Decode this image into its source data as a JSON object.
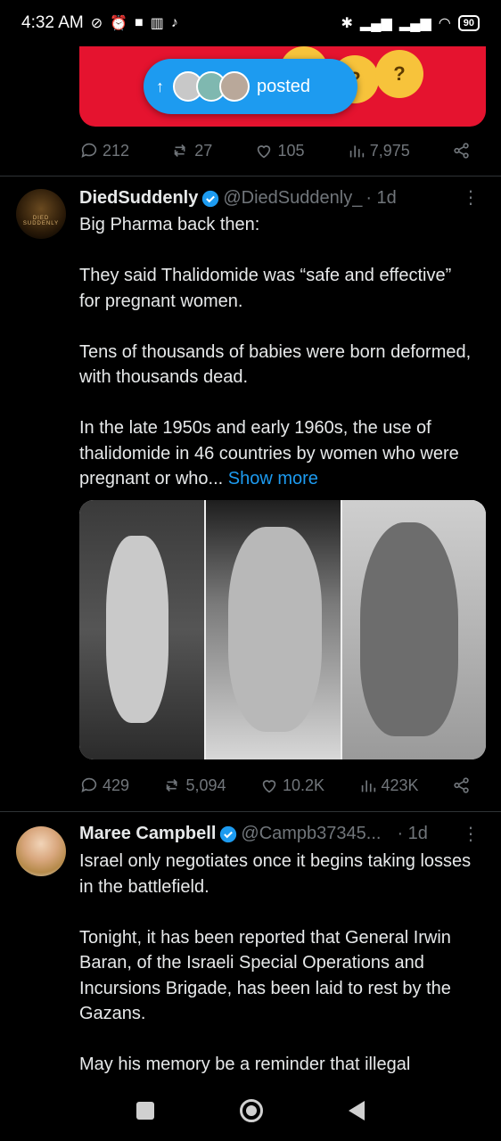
{
  "status_bar": {
    "time": "4:32 AM",
    "battery": "90"
  },
  "posted_pill": {
    "label": "posted"
  },
  "prev_tweet_actions": {
    "replies": "212",
    "reposts": "27",
    "likes": "105",
    "views": "7,975"
  },
  "tweet1": {
    "name": "DiedSuddenly",
    "handle": "@DiedSuddenly_",
    "time": "· 1d",
    "avatar_text": "DIED SUDDENLY",
    "paragraphs": [
      "Big Pharma back then:",
      "They said Thalidomide was “safe and effective” for pregnant women.",
      "Tens of thousands of babies were born deformed, with thousands dead.",
      "In the late 1950s and early 1960s, the use of thalidomide in 46 countries by women who were pregnant or who..."
    ],
    "show_more": "Show more",
    "actions": {
      "replies": "429",
      "reposts": "5,094",
      "likes": "10.2K",
      "views": "423K"
    }
  },
  "tweet2": {
    "name": "Maree Campbell",
    "handle": "@Campb37345...",
    "time": "· 1d",
    "paragraphs": [
      "Israel only negotiates once it begins taking losses in the battlefield.",
      "Tonight, it has been reported that General Irwin Baran, of the Israeli Special Operations and Incursions Brigade, has been laid to rest by the Gazans.",
      "May his memory be a reminder that illegal"
    ]
  },
  "colors": {
    "accent": "#1d9bf0",
    "muted": "#71767b",
    "banner": "#e5132f"
  }
}
